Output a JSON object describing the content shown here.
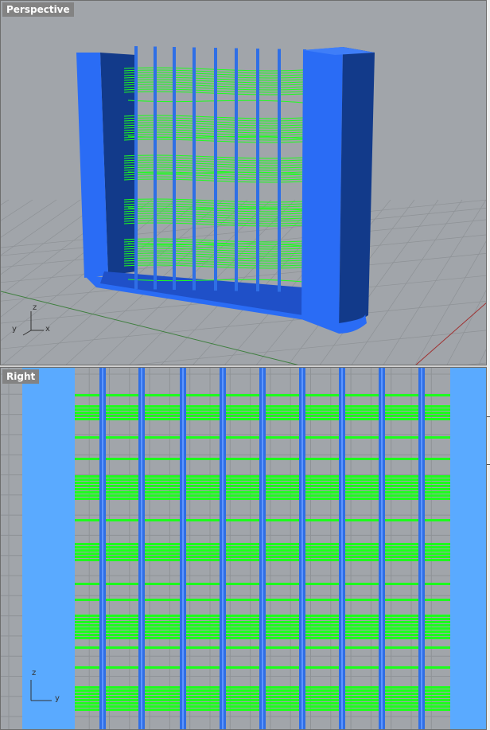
{
  "viewports": [
    {
      "label": "Perspective",
      "axes": {
        "x": "x",
        "y": "y",
        "z": "z"
      }
    },
    {
      "label": "Right",
      "axes": {
        "y": "y",
        "z": "z"
      }
    }
  ],
  "colors": {
    "background": "#a1a5aa",
    "frame": "#2a6cf5",
    "frame_dark": "#123a8a",
    "rod": "#2f6fe6",
    "curve": "#1cff1c",
    "right_panel": "#5aaaff"
  }
}
